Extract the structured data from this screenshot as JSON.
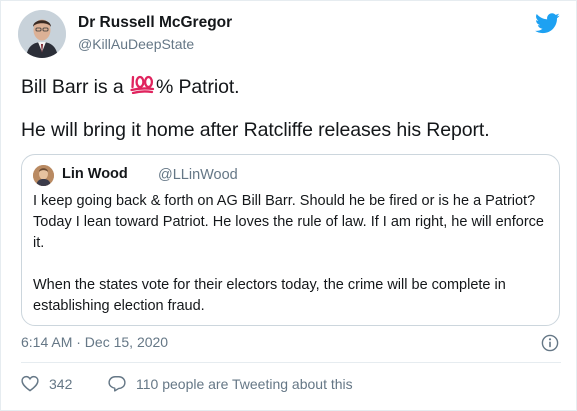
{
  "tweet": {
    "author_name": "Dr Russell McGregor",
    "author_handle": "@KillAuDeepState",
    "line1_before": "Bill Barr is a ",
    "line1_emoji": "hundred-points-emoji",
    "line1_after": "% Patriot.",
    "line2": "He will bring it home after Ratcliffe releases his Report.",
    "timestamp": "6:14 AM · Dec 15, 2020",
    "like_count": "342",
    "reply_text": "110 people are Tweeting about this"
  },
  "quoted": {
    "author_name": "Lin Wood",
    "author_handle": "@LLinWood",
    "paragraph1": "I keep going back & forth on AG Bill Barr. Should he be fired or is he a Patriot? Today I lean toward Patriot. He loves the rule of law. If I am right, he will enforce it.",
    "paragraph2": "When the states vote for their electors today, the crime will be complete in establishing election fraud."
  },
  "icons": {
    "brand": "twitter-bird-icon",
    "info": "info-icon",
    "like": "heart-icon",
    "reply": "speech-bubble-icon"
  },
  "colors": {
    "brand": "#1da1f2",
    "text": "#14171a",
    "muted": "#657786",
    "border": "#ccd6dd",
    "emoji_red": "#e0245e"
  }
}
